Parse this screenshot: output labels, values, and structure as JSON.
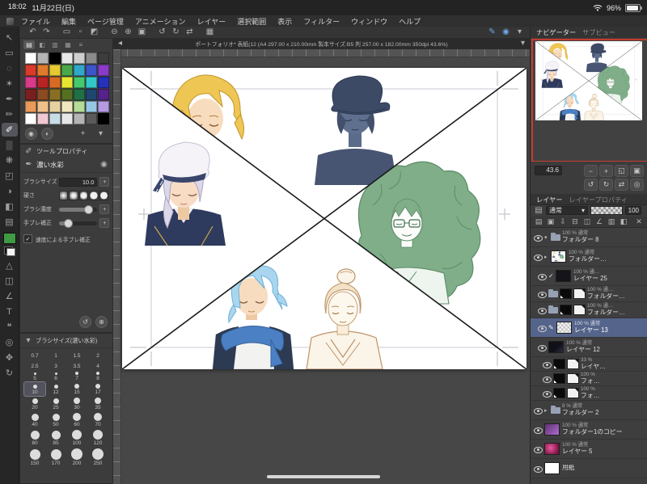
{
  "status_bar": {
    "time": "18:02",
    "date": "11月22日(日)",
    "battery": "96%"
  },
  "menu": {
    "items": [
      "ファイル",
      "編集",
      "ページ管理",
      "アニメーション",
      "レイヤー",
      "選択範囲",
      "表示",
      "フィルター",
      "ウィンドウ",
      "ヘルプ"
    ]
  },
  "document": {
    "title": "ポートフォリオ* 表紙(12 (A4 297.00 x 210.00mm 製本サイズ:B5 判 257.00 x 182.00mm 350dpi 43.6%)"
  },
  "icons": {
    "chevron_left": "◂",
    "chevron_down": "▾",
    "undo": "↶",
    "redo": "↷",
    "select_rect": "▭",
    "deselect": "▫",
    "invert_select": "◩",
    "zoom_out": "⊖",
    "zoom_in": "⊕",
    "fit_screen": "▣",
    "rotate_left": "↺",
    "rotate_right": "↻",
    "flip": "⇄",
    "grid": "▦",
    "pen_mode": "✎",
    "touch_mode": "◉",
    "tool_move": "↖",
    "tool_marquee": "▭",
    "tool_lasso": "◌",
    "tool_wand": "✶",
    "tool_pen": "✒",
    "tool_pencil": "✏",
    "tool_brush": "✐",
    "tool_airbrush": "▒",
    "tool_decoration": "❋",
    "tool_eraser": "◰",
    "tool_blend": "◑",
    "tool_fill": "◧",
    "tool_gradient": "▤",
    "tool_figure": "△",
    "tool_frame": "◫",
    "tool_ruler": "∠",
    "tool_text": "T",
    "tool_balloon": "❝",
    "tool_eyedrop": "◎",
    "tool_hand": "✥",
    "tool_rotate": "↻",
    "swatch_tab1": "▤",
    "swatch_tab2": "◧",
    "swatch_tab3": "▥",
    "swatch_tab4": "▦",
    "swatch_tab5": "≡",
    "color_wheel": "◉",
    "color_mixer": "◐",
    "palette_plus": "+",
    "palette_menu": "▾",
    "prop_reset": "↺",
    "prop_add": "⊕",
    "subtool_lock": "◉",
    "plus_box": "+",
    "minus": "−",
    "plus": "+",
    "nav_fit": "◱",
    "nav_100": "▣",
    "nav_flip": "⇄",
    "nav_reset": "◎",
    "blend_icon": "▤",
    "new_layer": "▤",
    "new_folder": "▣",
    "transfer": "⇩",
    "merge": "⊟",
    "mask": "◫",
    "ruler_layer": "∠",
    "onion": "▥",
    "light": "◧",
    "trash": "✕",
    "check": "✓",
    "pencil": "✎",
    "arrow_open": "▾",
    "arrow_closed": "▸"
  },
  "color_set": {
    "rows": [
      [
        "#ffffff",
        "#b5b5b5",
        "#000000",
        "#e9e9e9",
        "#cfcfcf",
        "#8a8a8a",
        "#3d3d3d"
      ],
      [
        "#d93a2b",
        "#e07a2b",
        "#e6c832",
        "#4aa84a",
        "#32a8c8",
        "#3c55c8",
        "#8a3cc8"
      ],
      [
        "#d93a8a",
        "#b82323",
        "#d96a23",
        "#e6e632",
        "#46c86e",
        "#32c8c8",
        "#2332b8"
      ],
      [
        "#7a1f1f",
        "#8a4a23",
        "#8a6f23",
        "#55701f",
        "#1f7046",
        "#1f4670",
        "#55238a"
      ],
      [
        "#e89a5a",
        "#eec08a",
        "#e6d2a0",
        "#f0e6c0",
        "#b4dc96",
        "#96c8e6",
        "#b49ae0"
      ],
      [
        "#ffffff",
        "#f0c8d2",
        "#c8dce6",
        "#e6e6e6",
        "#b4b4b4",
        "#5a5a5a",
        "#000000"
      ]
    ]
  },
  "tool_property": {
    "tab": "ツールプロパティ",
    "subtool": "濃い水彩",
    "size_label": "ブラシサイズ",
    "size_value": "10.0",
    "hardness_label": "硬さ",
    "density_label": "ブラシ濃度",
    "stabilize_label": "手ブレ補正",
    "speed_label": "速度による手ブレ補正"
  },
  "brush_sizes": {
    "title": "ブラシサイズ(濃い水彩)",
    "rows": [
      [
        "0.7",
        "1",
        "1.5",
        "2"
      ],
      [
        "2.5",
        "3",
        "3.5",
        "4"
      ],
      [
        "5",
        "6",
        "7",
        "8"
      ],
      [
        "10",
        "12",
        "15",
        "17"
      ],
      [
        "20",
        "25",
        "30",
        "35"
      ],
      [
        "40",
        "50",
        "60",
        "70"
      ],
      [
        "80",
        "85",
        "100",
        "120"
      ],
      [
        "150",
        "170",
        "200",
        "250"
      ]
    ]
  },
  "navigator": {
    "tab": "ナビゲーター",
    "tab2": "サブビュー",
    "zoom": "43.6"
  },
  "layers_panel": {
    "tab": "レイヤー",
    "tab2": "レイヤープロパティ",
    "blend_mode": "通常",
    "opacity": "100",
    "layers": [
      {
        "meta": "100 % 通常",
        "name": "フォルダー 8"
      },
      {
        "meta": "100 % 通常",
        "name": "フォルダー…"
      },
      {
        "meta": "100 % 通…",
        "name": "レイヤー 25"
      },
      {
        "meta": "100 % 通…",
        "name": "フォルダー…"
      },
      {
        "meta": "100 % 通…",
        "name": "フォルダー…"
      },
      {
        "meta": "100 % 通常",
        "name": "レイヤー 13"
      },
      {
        "meta": "100 % 通常",
        "name": "レイヤー 12"
      },
      {
        "meta": "33 %",
        "name": "レイヤ…"
      },
      {
        "meta": "100 %",
        "name": "フォ…"
      },
      {
        "meta": "100 %",
        "name": "フォ…"
      },
      {
        "meta": "8 % 通常",
        "name": "フォルダー 2"
      },
      {
        "meta": "100 % 通常",
        "name": "フォルダー1のコピー"
      },
      {
        "meta": "100 % 通常",
        "name": "レイヤー 5"
      },
      {
        "name": "用紙"
      }
    ]
  },
  "colors": {
    "accent_blue": "#6fa8e8",
    "selected_row": "#55648a",
    "nav_frame_red": "#c83a2e",
    "fg_chip_green": "#3f9a44"
  }
}
